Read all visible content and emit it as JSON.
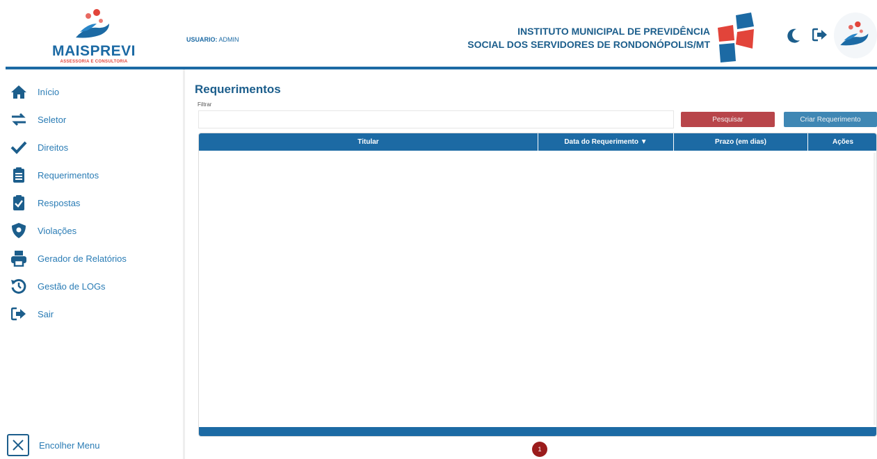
{
  "header": {
    "brand_name": "MAISPREVI",
    "brand_tagline": "ASSESSORIA E CONSULTORIA",
    "user_label": "USUARIO:",
    "user_name": "ADMIN",
    "institute_line1": "INSTITUTO MUNICIPAL DE PREVIDÊNCIA",
    "institute_line2": "SOCIAL DOS SERVIDORES DE RONDONÓPOLIS/MT",
    "icons": [
      "moon-icon",
      "logout-icon",
      "avatar"
    ]
  },
  "sidebar": {
    "items": [
      {
        "label": "Início",
        "icon": "home-icon"
      },
      {
        "label": "Seletor",
        "icon": "exchange-icon"
      },
      {
        "label": "Direitos",
        "icon": "check-icon"
      },
      {
        "label": "Requerimentos",
        "icon": "clipboard-list-icon"
      },
      {
        "label": "Respostas",
        "icon": "clipboard-check-icon"
      },
      {
        "label": "Violações",
        "icon": "shield-icon"
      },
      {
        "label": "Gerador de Relatórios",
        "icon": "printer-icon"
      },
      {
        "label": "Gestão de LOGs",
        "icon": "history-icon"
      },
      {
        "label": "Sair",
        "icon": "sign-out-icon"
      }
    ],
    "collapse_label": "Encolher Menu"
  },
  "main": {
    "title": "Requerimentos",
    "filter_label": "Filtrar",
    "filter_value": "",
    "search_button": "Pesquisar",
    "create_button": "Criar Requerimento",
    "table": {
      "columns": [
        "Titular",
        "Data do Requerimento ▼",
        "Prazo (em dias)",
        "Ações"
      ],
      "rows": []
    },
    "pagination": {
      "current_page": "1"
    }
  },
  "colors": {
    "primary": "#1c6aa4",
    "danger": "#b8454a",
    "accent_blue": "#3f87b4",
    "page_badge": "#9b1c1c",
    "brand_red": "#e2443a"
  }
}
